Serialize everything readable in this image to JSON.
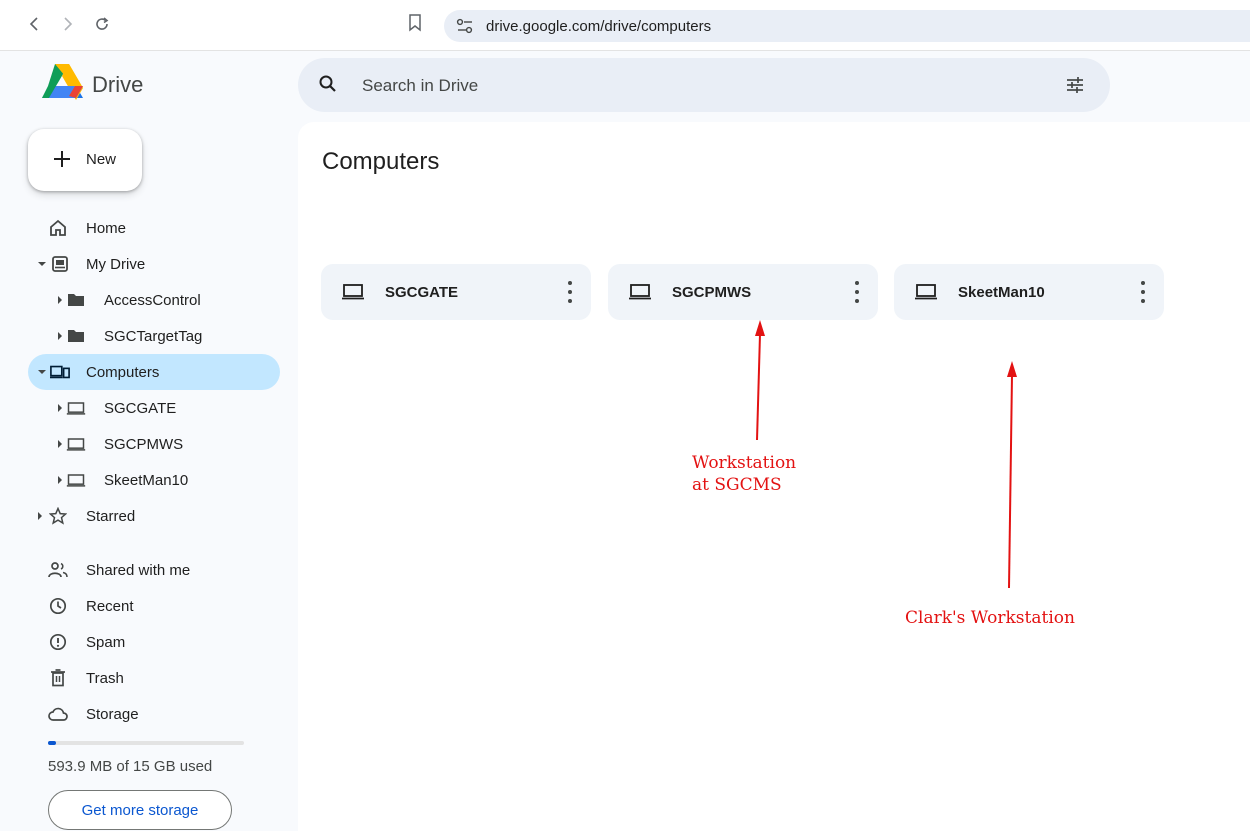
{
  "browser": {
    "url": "drive.google.com/drive/computers"
  },
  "app": {
    "brand": "Drive",
    "new_label": "New"
  },
  "search": {
    "placeholder": "Search in Drive"
  },
  "sidebar": {
    "home": "Home",
    "my_drive": "My Drive",
    "my_drive_children": [
      "AccessControl",
      "SGCTargetTag"
    ],
    "computers": "Computers",
    "computers_children": [
      "SGCGATE",
      "SGCPMWS",
      "SkeetMan10"
    ],
    "starred": "Starred",
    "shared": "Shared with me",
    "recent": "Recent",
    "spam": "Spam",
    "trash": "Trash",
    "storage": "Storage"
  },
  "storage": {
    "used_text": "593.9 MB of 15 GB used",
    "used_fraction": 0.04,
    "button_label": "Get more storage"
  },
  "main": {
    "title": "Computers",
    "computers": [
      {
        "name": "SGCGATE"
      },
      {
        "name": "SGCPMWS"
      },
      {
        "name": "SkeetMan10"
      }
    ]
  },
  "annotations": {
    "sgcpmws_note_line1": "Workstation",
    "sgcpmws_note_line2": "at SGCMS",
    "skeetman_note": "Clark's Workstation",
    "color": "#e31212"
  },
  "colors": {
    "active_nav": "#c2e7ff",
    "accent": "#0b57d0"
  }
}
